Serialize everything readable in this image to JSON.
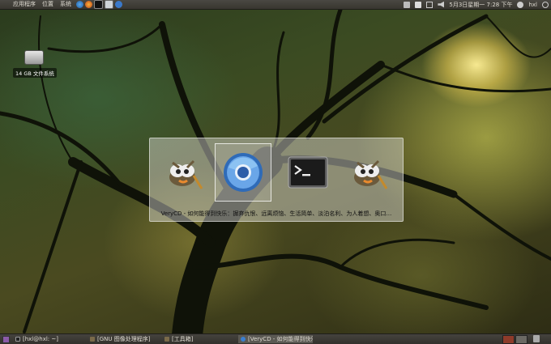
{
  "top_panel": {
    "menus": [
      "应用程序",
      "位置",
      "系统"
    ],
    "clock": "5月3日星期一 7:28 下午",
    "user": "hxl"
  },
  "desktop": {
    "drive_label": "14 GB 文件系统"
  },
  "switcher": {
    "items": [
      {
        "app": "gimp",
        "icon": "gimp-icon"
      },
      {
        "app": "chromium",
        "icon": "chromium-icon",
        "selected": true
      },
      {
        "app": "terminal",
        "icon": "terminal-icon"
      },
      {
        "app": "gimp",
        "icon": "gimp-icon"
      }
    ],
    "caption": "VeryCD - 如何能得到快乐：摒弃仇恨、远离烦恼、生活简单、淡泊名利、为人着想、奥口…"
  },
  "taskbar": {
    "tasks": [
      {
        "label": "[hxl@hxl: ~]",
        "icon": "terminal-icon"
      },
      {
        "label": "[GNU 图像处理程序]",
        "icon": "gimp-icon"
      },
      {
        "label": "[工具箱]",
        "icon": "gimp-icon"
      },
      {
        "label": "[VeryCD - 如何能得到快乐",
        "icon": "chromium-icon",
        "active": true
      }
    ]
  },
  "colors": {
    "panel": "#3f3d38",
    "panel_text": "#dfdbd2",
    "active_workspace": "#8e3b2a"
  }
}
